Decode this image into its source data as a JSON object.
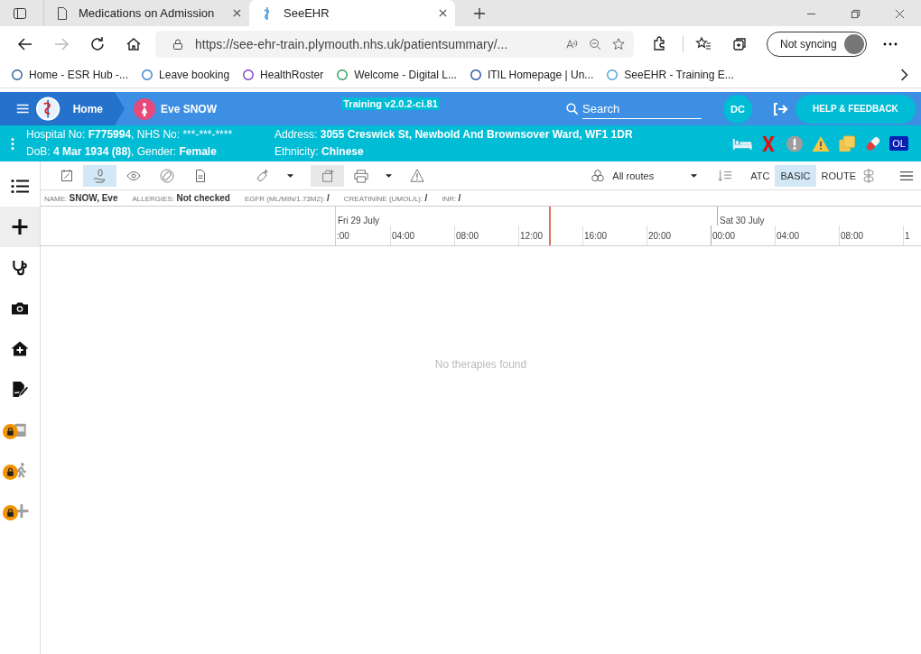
{
  "browser": {
    "tabs": [
      {
        "title": "Medications on Admission",
        "selected": false
      },
      {
        "title": "SeeEHR",
        "selected": true
      }
    ],
    "url": "https://see-ehr-train.plymouth.nhs.uk/patientsummary/...",
    "sync_label": "Not syncing",
    "bookmarks": [
      "Home - ESR Hub -...",
      "Leave booking",
      "HealthRoster",
      "Welcome - Digital L...",
      "ITIL Homepage | Un...",
      "SeeEHR - Training E..."
    ]
  },
  "header": {
    "home": "Home",
    "patient": "Eve SNOW",
    "environment": "Training v2.0.2-ci.81",
    "search": {
      "placeholder": "Search"
    },
    "user_initials": "DC",
    "help_button": "HELP & FEEDBACK"
  },
  "banner": {
    "lines": [
      [
        {
          "text": "Hospital No: ",
          "bold": false
        },
        {
          "text": "F775994",
          "bold": true
        },
        {
          "text": ", NHS No: ***-***-****",
          "bold": false
        }
      ],
      [
        {
          "text": "DoB: ",
          "bold": false
        },
        {
          "text": "4 Mar 1934 (88)",
          "bold": true
        },
        {
          "text": ", Gender: ",
          "bold": false
        },
        {
          "text": "Female",
          "bold": true
        }
      ],
      [
        {
          "text": "Address: ",
          "bold": false
        },
        {
          "text": "3055 Creswick St, Newbold And Brownsover Ward, WF1 1DR",
          "bold": true
        }
      ],
      [
        {
          "text": "Ethnicity: ",
          "bold": false
        },
        {
          "text": "Chinese",
          "bold": true
        }
      ]
    ],
    "badge": "OL"
  },
  "sidebar": {
    "items": [
      {
        "selected": false,
        "locked": false
      },
      {
        "selected": true,
        "locked": false
      },
      {
        "selected": false,
        "locked": false
      },
      {
        "selected": false,
        "locked": false
      },
      {
        "selected": false,
        "locked": false
      },
      {
        "selected": false,
        "locked": false
      },
      {
        "selected": false,
        "locked": true
      },
      {
        "selected": false,
        "locked": true
      },
      {
        "selected": false,
        "locked": true
      }
    ]
  },
  "toolbar": {
    "tools": [
      {
        "selected": false
      },
      {
        "selected": true
      },
      {
        "selected": false
      },
      {
        "selected": false
      },
      {
        "selected": false
      }
    ],
    "routes_dropdown": "All routes",
    "views": [
      {
        "label": "ATC",
        "selected": false
      },
      {
        "label": "BASIC",
        "selected": true
      },
      {
        "label": "ROUTE",
        "selected": false
      }
    ]
  },
  "info": [
    {
      "label": "NAME:",
      "value": "SNOW, Eve"
    },
    {
      "label": "ALLERGIES:",
      "value": "Not checked"
    },
    {
      "label": "EGFR (ML/MIN/1.73M2):",
      "value": "/"
    },
    {
      "label": "CREATININE (UMOL/L):",
      "value": "/"
    },
    {
      "label": "INR:",
      "value": "/"
    }
  ],
  "timeline": {
    "days": [
      "Fri 29 July",
      "Sat 30 July"
    ],
    "hours": [
      ":00",
      "04:00",
      "08:00",
      "12:00",
      "16:00",
      "20:00",
      "00:00",
      "04:00",
      "08:00",
      "1"
    ],
    "empty_message": "No therapies found"
  }
}
